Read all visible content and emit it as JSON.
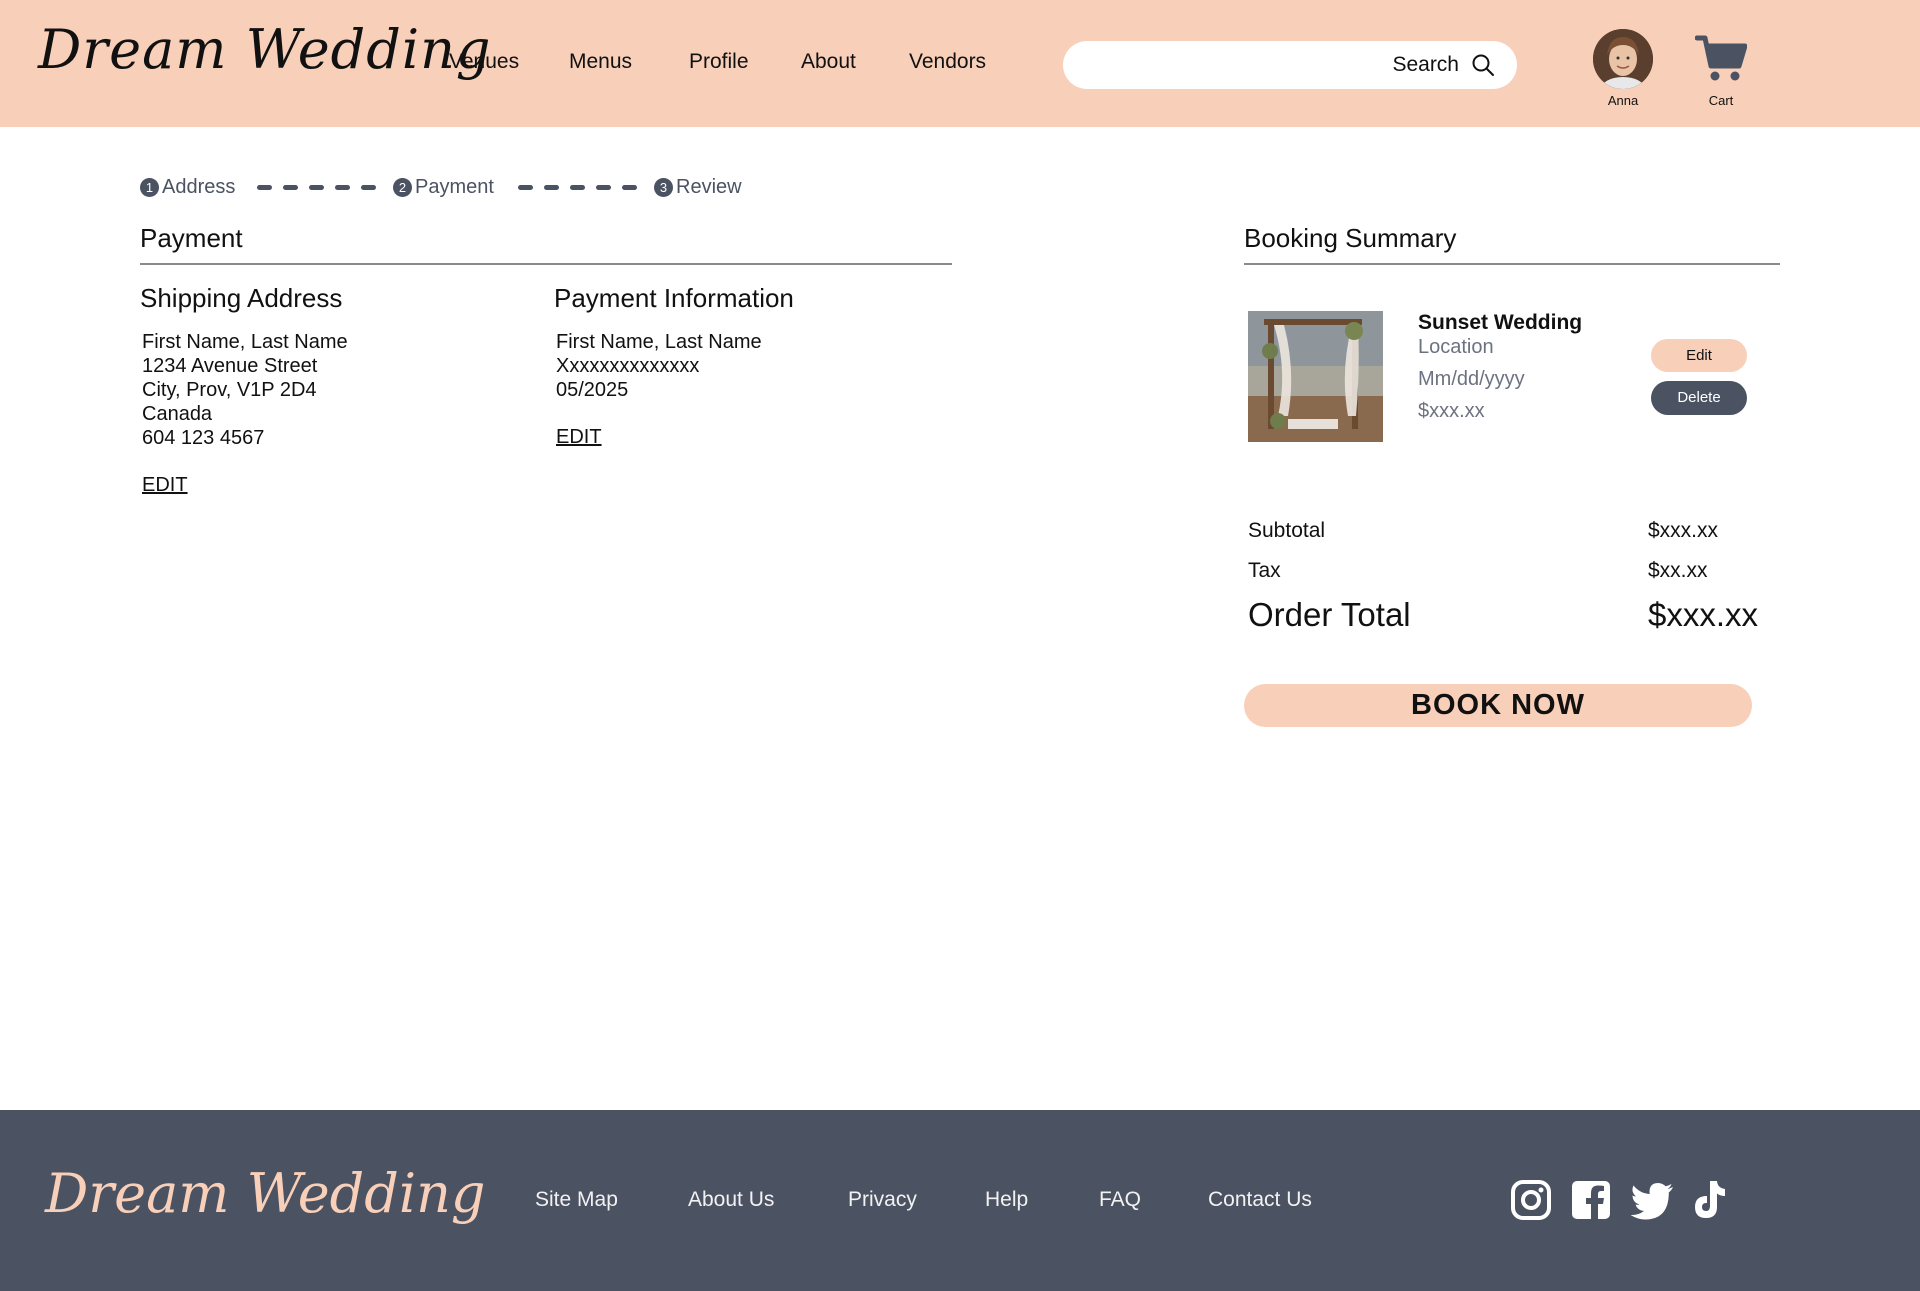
{
  "header": {
    "logo": "Dream Wedding",
    "nav": [
      "Venues",
      "Menus",
      "Profile",
      "About",
      "Vendors"
    ],
    "search_label": "Search",
    "user_name": "Anna",
    "cart_label": "Cart"
  },
  "stepper": {
    "steps": [
      {
        "num": "1",
        "label": "Address"
      },
      {
        "num": "2",
        "label": "Payment"
      },
      {
        "num": "3",
        "label": "Review"
      }
    ]
  },
  "payment": {
    "title": "Payment",
    "shipping": {
      "title": "Shipping Address",
      "lines": [
        "First Name, Last Name",
        "1234 Avenue Street",
        "City, Prov, V1P 2D4",
        "Canada",
        "604 123 4567"
      ],
      "edit": "EDIT"
    },
    "payment_info": {
      "title": "Payment Information",
      "lines": [
        "First Name, Last Name",
        "Xxxxxxxxxxxxxx",
        "05/2025"
      ],
      "edit": "EDIT"
    }
  },
  "booking": {
    "title": "Booking Summary",
    "item": {
      "name": "Sunset Wedding",
      "location": "Location",
      "date": "Mm/dd/yyyy",
      "price": "$xxx.xx",
      "edit_label": "Edit",
      "delete_label": "Delete"
    },
    "subtotal_label": "Subtotal",
    "subtotal_value": "$xxx.xx",
    "tax_label": "Tax",
    "tax_value": "$xx.xx",
    "total_label": "Order Total",
    "total_value": "$xxx.xx",
    "book_label": "BOOK NOW"
  },
  "footer": {
    "logo": "Dream Wedding",
    "links": [
      "Site Map",
      "About Us",
      "Privacy",
      "Help",
      "FAQ",
      "Contact Us"
    ],
    "social_icons": [
      "instagram-icon",
      "facebook-icon",
      "twitter-icon",
      "tiktok-icon"
    ]
  },
  "colors": {
    "brand_peach": "#f8cfb8",
    "slate": "#4b5262"
  }
}
